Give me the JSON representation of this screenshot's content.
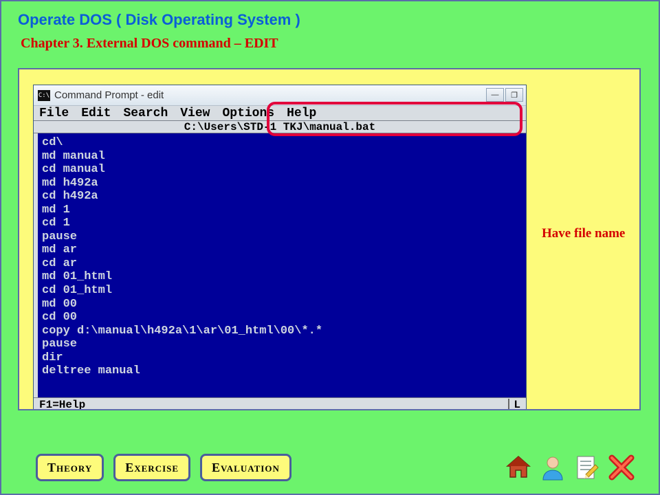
{
  "page": {
    "title": "Operate DOS ( Disk Operating System )",
    "chapter": "Chapter 3.    External DOS command – EDIT"
  },
  "annotation": "Have file name",
  "cmd": {
    "title": "Command Prompt - edit",
    "sys_icon": "C:\\",
    "min_glyph": "—",
    "max_glyph": "❐",
    "menu": {
      "file": "File",
      "edit": "Edit",
      "search": "Search",
      "view": "View",
      "options": "Options",
      "help": "Help"
    },
    "path": "C:\\Users\\STD-1 TKJ\\manual.bat",
    "body": "cd\\\nmd manual\ncd manual\nmd h492a\ncd h492a\nmd 1\ncd 1\npause\nmd ar\ncd ar\nmd 01_html\ncd 01_html\nmd 00\ncd 00\ncopy d:\\manual\\h492a\\1\\ar\\01_html\\00\\*.*\npause\ndir\ndeltree manual",
    "status_left": "F1=Help",
    "status_right": "L"
  },
  "nav": {
    "theory": "Theory",
    "exercise": "Exercise",
    "evaluation": "Evaluation"
  }
}
